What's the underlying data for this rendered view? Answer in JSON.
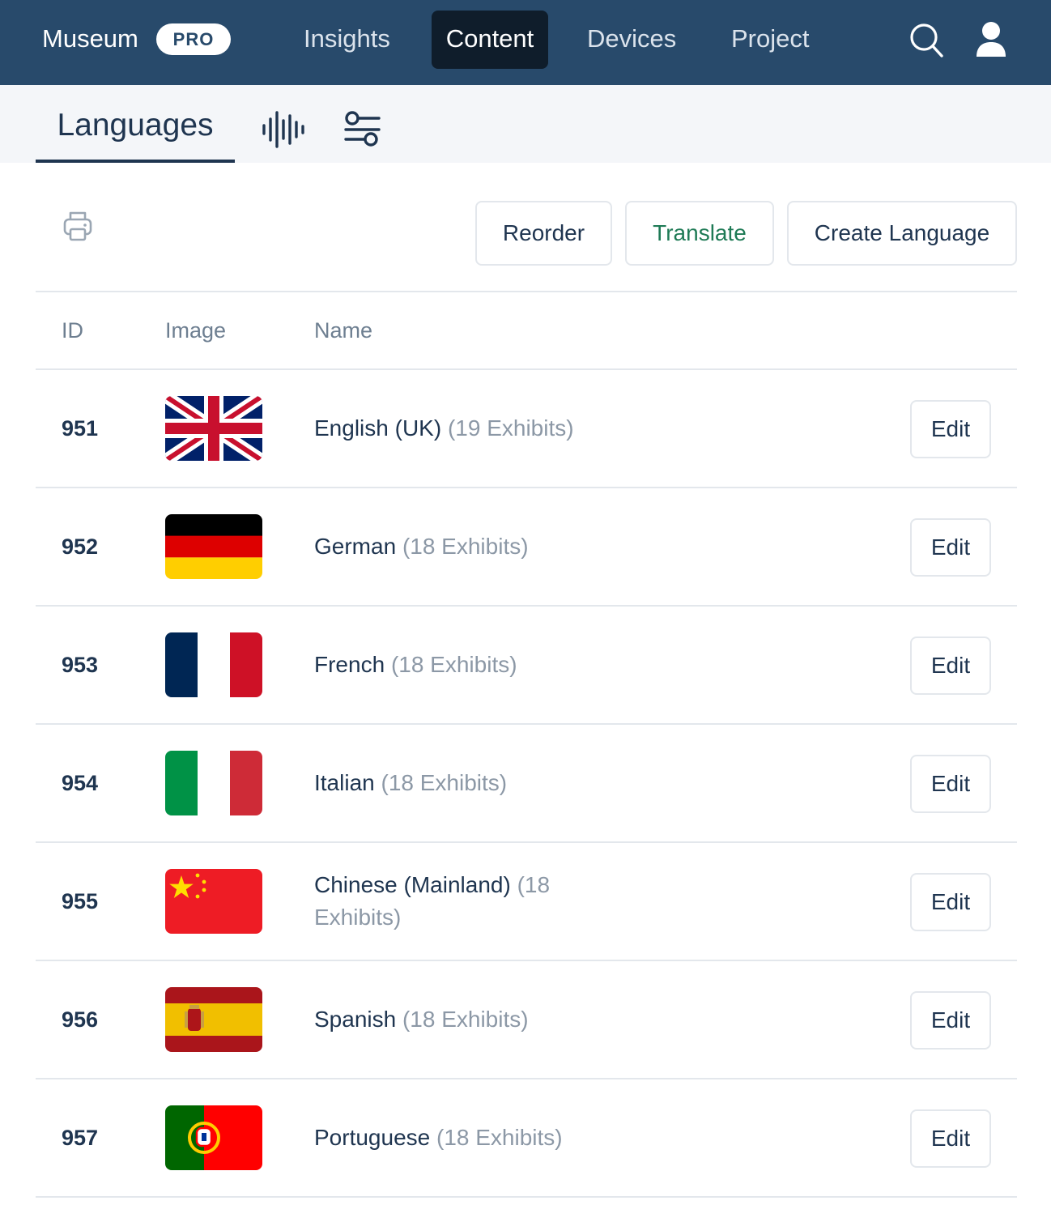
{
  "topnav": {
    "brand": "Museum",
    "badge": "PRO",
    "items": [
      {
        "label": "Insights",
        "active": false
      },
      {
        "label": "Content",
        "active": true
      },
      {
        "label": "Devices",
        "active": false
      },
      {
        "label": "Project",
        "active": false
      }
    ],
    "icons": [
      "search-icon",
      "user-icon"
    ],
    "colors": {
      "background": "#284a6b",
      "active": "#0f1d2b"
    }
  },
  "subnav": {
    "tabs": [
      {
        "label": "Languages",
        "active": true
      },
      {
        "icon": "audio-waveform-icon"
      },
      {
        "icon": "filters-icon"
      }
    ]
  },
  "toolbar": {
    "print_icon": "printer-icon",
    "buttons": [
      "Reorder",
      "Translate",
      "Create Language"
    ]
  },
  "table": {
    "headers": [
      "ID",
      "Image",
      "Name"
    ],
    "rows": [
      {
        "id": "951",
        "flag": "uk-flag",
        "name": "English (UK)",
        "exhibits": "(19 Exhibits)",
        "action": "Edit"
      },
      {
        "id": "952",
        "flag": "germany-flag",
        "name": "German",
        "exhibits": "(18 Exhibits)",
        "action": "Edit"
      },
      {
        "id": "953",
        "flag": "france-flag",
        "name": "French",
        "exhibits": "(18 Exhibits)",
        "action": "Edit"
      },
      {
        "id": "954",
        "flag": "italy-flag",
        "name": "Italian",
        "exhibits": "(18 Exhibits)",
        "action": "Edit"
      },
      {
        "id": "955",
        "flag": "china-flag",
        "name": "Chinese (Mainland)",
        "exhibits": "(18 Exhibits)",
        "action": "Edit"
      },
      {
        "id": "956",
        "flag": "spain-flag",
        "name": "Spanish",
        "exhibits": "(18 Exhibits)",
        "action": "Edit"
      },
      {
        "id": "957",
        "flag": "portugal-flag",
        "name": "Portuguese",
        "exhibits": "(18 Exhibits)",
        "action": "Edit"
      }
    ]
  }
}
